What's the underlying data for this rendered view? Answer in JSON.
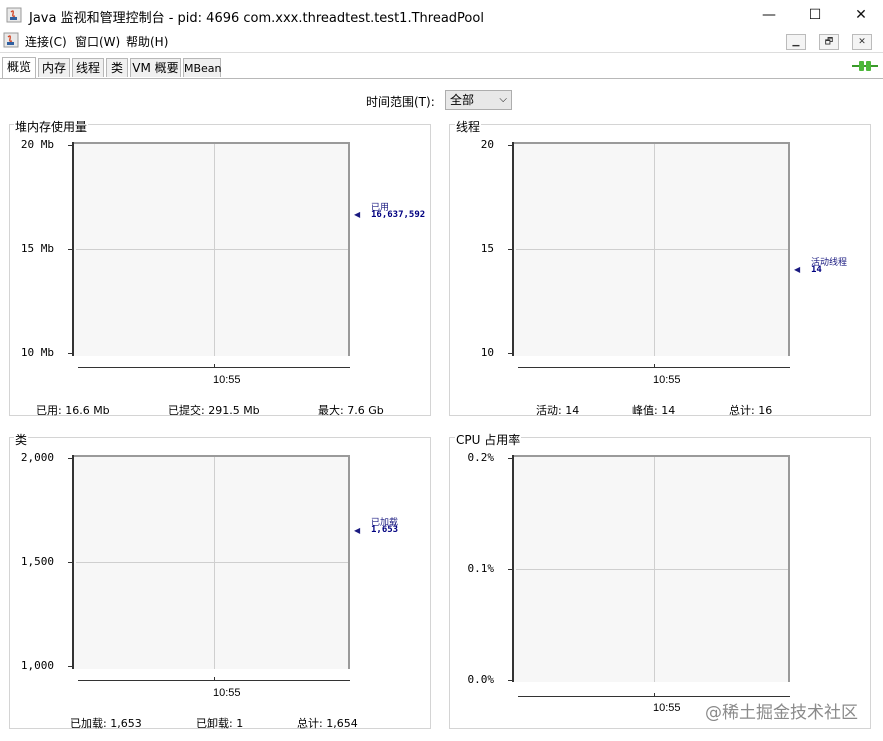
{
  "window": {
    "title": "Java 监视和管理控制台 - pid: 4696 com.xxx.threadtest.test1.ThreadPool",
    "minimize": "—",
    "maximize": "☐",
    "close": "✕"
  },
  "menu": {
    "items": [
      "连接(C)",
      "窗口(W)",
      "帮助(H)"
    ],
    "mdi": [
      "▁",
      "🗗",
      "✕"
    ]
  },
  "tabs": [
    "概览",
    "内存",
    "线程",
    "类",
    "VM 概要",
    "MBean"
  ],
  "time_range": {
    "label": "时间范围(T):",
    "value": "全部"
  },
  "panels": {
    "heap": {
      "title": "堆内存使用量",
      "y_ticks": [
        "20 Mb",
        "15 Mb",
        "10 Mb"
      ],
      "x_tick": "10:55",
      "legend_name": "已用",
      "legend_value": "16,637,592",
      "stats": [
        "已用:  16.6  Mb",
        "已提交:  291.5  Mb",
        "最大:  7.6  Gb"
      ]
    },
    "threads": {
      "title": "线程",
      "y_ticks": [
        "20",
        "15",
        "10"
      ],
      "x_tick": "10:55",
      "legend_name": "活动线程",
      "legend_value": "14",
      "stats": [
        "活动:  14",
        "峰值:  14",
        "总计:  16"
      ]
    },
    "classes": {
      "title": "类",
      "y_ticks": [
        "2,000",
        "1,500",
        "1,000"
      ],
      "x_tick": "10:55",
      "legend_name": "已加载",
      "legend_value": "1,653",
      "stats": [
        "已加载:  1,653",
        "已卸载:  1",
        "总计:  1,654"
      ]
    },
    "cpu": {
      "title": "CPU 占用率",
      "y_ticks": [
        "0.2%",
        "0.1%",
        "0.0%"
      ],
      "x_tick": "10:55"
    }
  },
  "watermark": "@稀土掘金技术社区",
  "colors": {
    "legend": "#1a1a80",
    "plot_bg": "#f7f7f7"
  }
}
